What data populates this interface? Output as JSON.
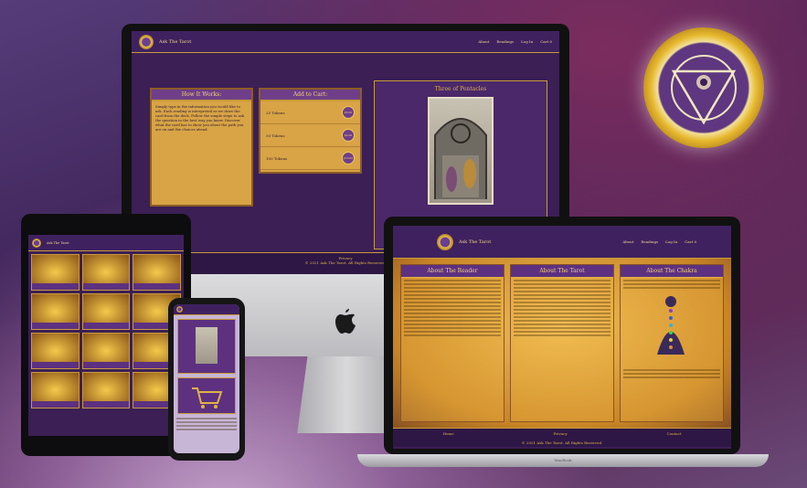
{
  "site": {
    "brand": "Ask The Tarot",
    "nav": [
      "About",
      "Readings",
      "Log In",
      "Cart 0"
    ],
    "footer_links": [
      "Home",
      "Privacy",
      "Contact"
    ],
    "copyright": "© 2021 Ask The Tarot. All Rights Reserved."
  },
  "desktop": {
    "how_title": "How It Works:",
    "how_text": "Simply type in the information you would like to ask. Each reading is interpreted as we draw the card from the deck. Follow the simple steps to ask the question in the best way you know. Discover what the card has to show you about the path you are on and the choices ahead.",
    "cart_title": "Add to Cart:",
    "cart_rows": [
      {
        "label": "25 Tokens",
        "price": "$5.00"
      },
      {
        "label": "50 Tokens",
        "price": "$9.00"
      },
      {
        "label": "100 Tokens",
        "price": "$16.00"
      }
    ],
    "card_title": "Three of Pentacles"
  },
  "laptop": {
    "columns": [
      {
        "title": "About The Reader"
      },
      {
        "title": "About The Tarot"
      },
      {
        "title": "About The Chakra"
      }
    ]
  },
  "badge": {
    "icon": "third-eye-chakra-icon"
  },
  "devices": {
    "laptop_label": "MacBook"
  }
}
